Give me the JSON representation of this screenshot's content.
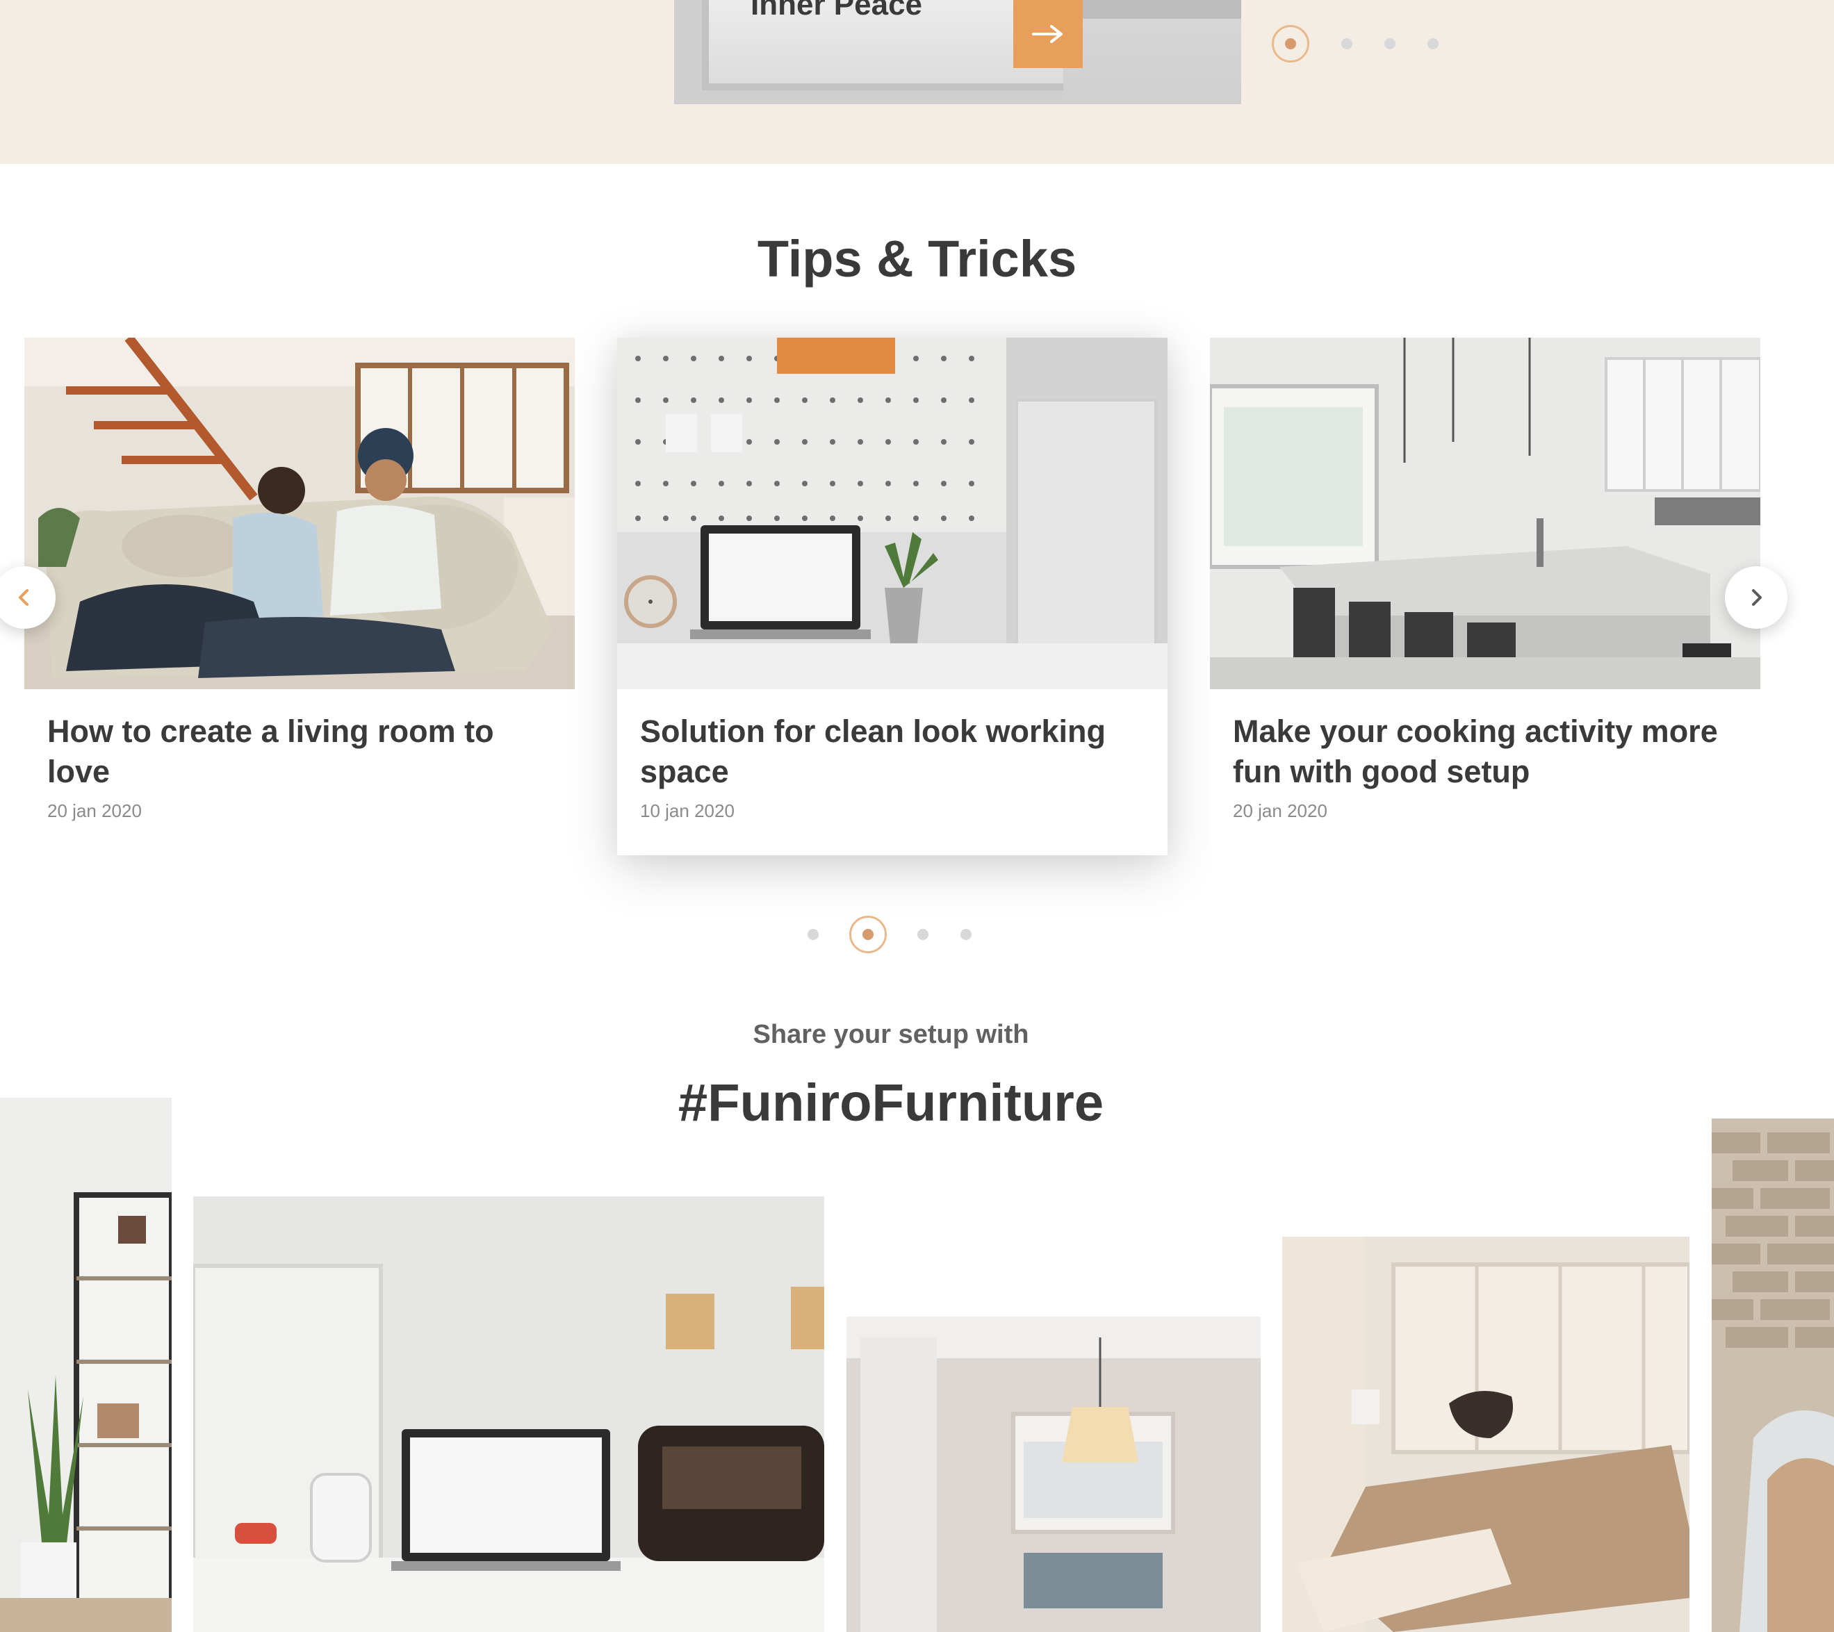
{
  "hero": {
    "title": "Inner Peace",
    "arrow_icon": "arrow-right-icon",
    "dots_total": 4,
    "active_dot": 1
  },
  "tips": {
    "heading": "Tips & Tricks",
    "prev_icon": "chevron-left-icon",
    "next_icon": "chevron-right-icon",
    "cards": [
      {
        "title": "How to create a living room to love",
        "date": "20 jan 2020"
      },
      {
        "title": "Solution for clean look working space",
        "date": "10 jan 2020"
      },
      {
        "title": "Make your cooking activity more fun with good setup",
        "date": "20 jan 2020"
      }
    ],
    "dots_total": 4,
    "active_dot": 2
  },
  "share": {
    "subtitle": "Share your setup with",
    "hashtag": "#FuniroFurniture"
  },
  "colors": {
    "accent": "#e89f5b",
    "band": "#f4ede3",
    "text_dark": "#3a3a3a",
    "text_muted": "#8a8a8a"
  }
}
